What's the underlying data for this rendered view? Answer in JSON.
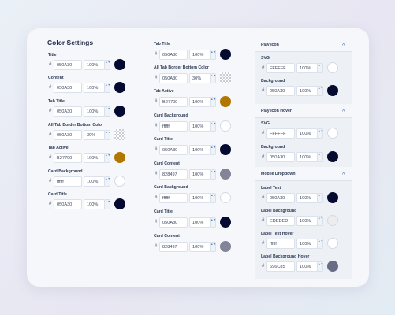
{
  "header": {
    "title": "Color Settings"
  },
  "left": [
    {
      "label": "Title",
      "hex": "050A30",
      "opacity": "100%",
      "color": "#050a30"
    },
    {
      "label": "Content",
      "hex": "050A30",
      "opacity": "100%",
      "color": "#050a30"
    },
    {
      "label": "Tab Title",
      "hex": "050A30",
      "opacity": "100%",
      "color": "#050a30"
    },
    {
      "label": "All Tab Border Bottom Color",
      "hex": "050A30",
      "opacity": "30%",
      "color": "transparent"
    },
    {
      "label": "Tab Active",
      "hex": "B27700",
      "opacity": "100%",
      "color": "#b27700"
    },
    {
      "label": "Card Background",
      "hex": "ffffff",
      "opacity": "100%",
      "color": "#ffffff"
    },
    {
      "label": "Card Title",
      "hex": "050A30",
      "opacity": "100%",
      "color": "#050a30"
    }
  ],
  "middle": [
    {
      "label": "Tab Title",
      "hex": "050A30",
      "opacity": "100%",
      "color": "#050a30"
    },
    {
      "label": "All Tab Border Bottom Color",
      "hex": "050A30",
      "opacity": "30%",
      "color": "transparent"
    },
    {
      "label": "Tab Active",
      "hex": "B27700",
      "opacity": "100%",
      "color": "#b27700"
    },
    {
      "label": "Card Background",
      "hex": "ffffff",
      "opacity": "100%",
      "color": "#ffffff"
    },
    {
      "label": "Card Title",
      "hex": "050A30",
      "opacity": "100%",
      "color": "#050a30"
    },
    {
      "label": "Card Content",
      "hex": "828497",
      "opacity": "100%",
      "color": "#828497"
    },
    {
      "label": "Card Background",
      "hex": "ffffff",
      "opacity": "100%",
      "color": "#ffffff"
    },
    {
      "label": "Card Title",
      "hex": "050A30",
      "opacity": "100%",
      "color": "#050a30"
    },
    {
      "label": "Card Content",
      "hex": "828497",
      "opacity": "100%",
      "color": "#828497"
    }
  ],
  "right": {
    "play_icon": {
      "title": "Play Icon",
      "fields": [
        {
          "label": "SVG",
          "hex": "FFFFFF",
          "opacity": "100%",
          "color": "#ffffff"
        },
        {
          "label": "Background",
          "hex": "050A30",
          "opacity": "100%",
          "color": "#050a30"
        }
      ]
    },
    "play_icon_hover": {
      "title": "Play Icon Hover",
      "fields": [
        {
          "label": "SVG",
          "hex": "FFFFFF",
          "opacity": "100%",
          "color": "#ffffff"
        },
        {
          "label": "Background",
          "hex": "050A30",
          "opacity": "100%",
          "color": "#050a30"
        }
      ]
    },
    "mobile_dropdown": {
      "title": "Mobile Dropdown",
      "fields": [
        {
          "label": "Label Text",
          "hex": "050A30",
          "opacity": "100%",
          "color": "#050a30"
        },
        {
          "label": "Label Background",
          "hex": "EDEDED",
          "opacity": "100%",
          "color": "#ededed"
        },
        {
          "label": "Label Text Hover",
          "hex": "ffffff",
          "opacity": "100%",
          "color": "#ffffff"
        },
        {
          "label": "Label Background Hover",
          "hex": "696C85",
          "opacity": "100%",
          "color": "#696c85"
        }
      ]
    }
  },
  "icons": {
    "hash": "#",
    "spin": "▲▼",
    "chevron": "^"
  }
}
